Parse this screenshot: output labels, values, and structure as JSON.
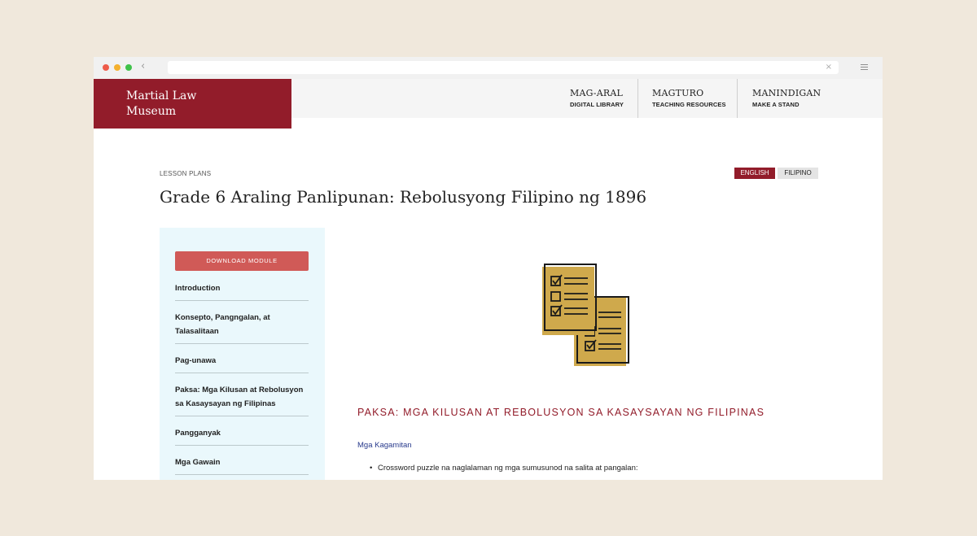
{
  "browser": {
    "back_glyph": "‹",
    "url_close_glyph": "×"
  },
  "site": {
    "logo_line1": "Martial Law",
    "logo_line2": "Museum",
    "nav": [
      {
        "title": "MAG-ARAL",
        "sub": "DIGITAL LIBRARY"
      },
      {
        "title": "MAGTURO",
        "sub": "TEACHING RESOURCES"
      },
      {
        "title": "MANINDIGAN",
        "sub": "MAKE A STAND"
      }
    ]
  },
  "page": {
    "breadcrumb": "LESSON PLANS",
    "lang_english": "ENGLISH",
    "lang_filipino": "FILIPINO",
    "title": "Grade 6 Araling Panlipunan: Rebolusyong Filipino ng 1896"
  },
  "sidebar": {
    "download_label": "DOWNLOAD MODULE",
    "items": [
      {
        "label": "Introduction"
      },
      {
        "label": "Konsepto, Pangngalan, at Talasalitaan"
      },
      {
        "label": "Pag-unawa"
      },
      {
        "label": "Paksa: Mga Kilusan at Rebolusyon sa Kasaysayan ng Filipinas"
      },
      {
        "label": "Pangganyak"
      },
      {
        "label": "Mga Gawain"
      }
    ]
  },
  "content": {
    "illustration_icon": "checklist-documents-icon",
    "section_heading": "PAKSA: MGA KILUSAN AT REBOLUSYON SA KASAYSAYAN NG FILIPINAS",
    "materials_label": "Mga Kagamitan",
    "bullet_1": "Crossword puzzle na naglalaman ng mga sumusunod na salita at pangalan:"
  },
  "colors": {
    "brand_red": "#921c2a",
    "download_red": "#d05a57",
    "sidebar_bg": "#eaf8fc",
    "icon_gold": "#cfa94c",
    "link_blue": "#283a8c",
    "page_bg": "#f0e8dc"
  }
}
